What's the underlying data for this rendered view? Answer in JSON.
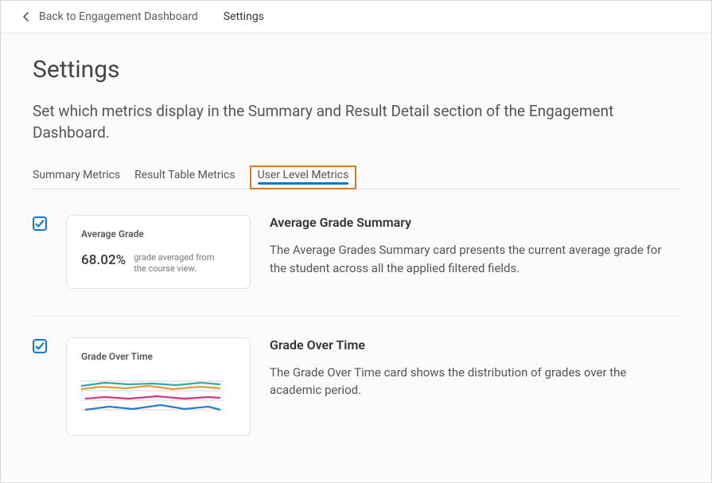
{
  "breadcrumb": {
    "back_label": "Back to Engagement Dashboard",
    "current": "Settings"
  },
  "page": {
    "title": "Settings",
    "description": "Set which metrics display in the Summary and Result Detail section of the Engagement Dashboard."
  },
  "tabs": [
    {
      "label": "Summary Metrics",
      "active": false
    },
    {
      "label": "Result Table Metrics",
      "active": false
    },
    {
      "label": "User Level Metrics",
      "active": true
    }
  ],
  "metrics": [
    {
      "checked": true,
      "preview": {
        "title": "Average Grade",
        "value": "68.02%",
        "subtext": "grade averaged from the course view."
      },
      "title": "Average Grade Summary",
      "description": "The Average Grades Summary card presents the current average grade for the student across all the applied filtered fields."
    },
    {
      "checked": true,
      "preview": {
        "title": "Grade Over Time",
        "chart": true
      },
      "title": "Grade Over Time",
      "description": "The Grade Over Time card shows the distribution of grades over the academic period."
    }
  ]
}
